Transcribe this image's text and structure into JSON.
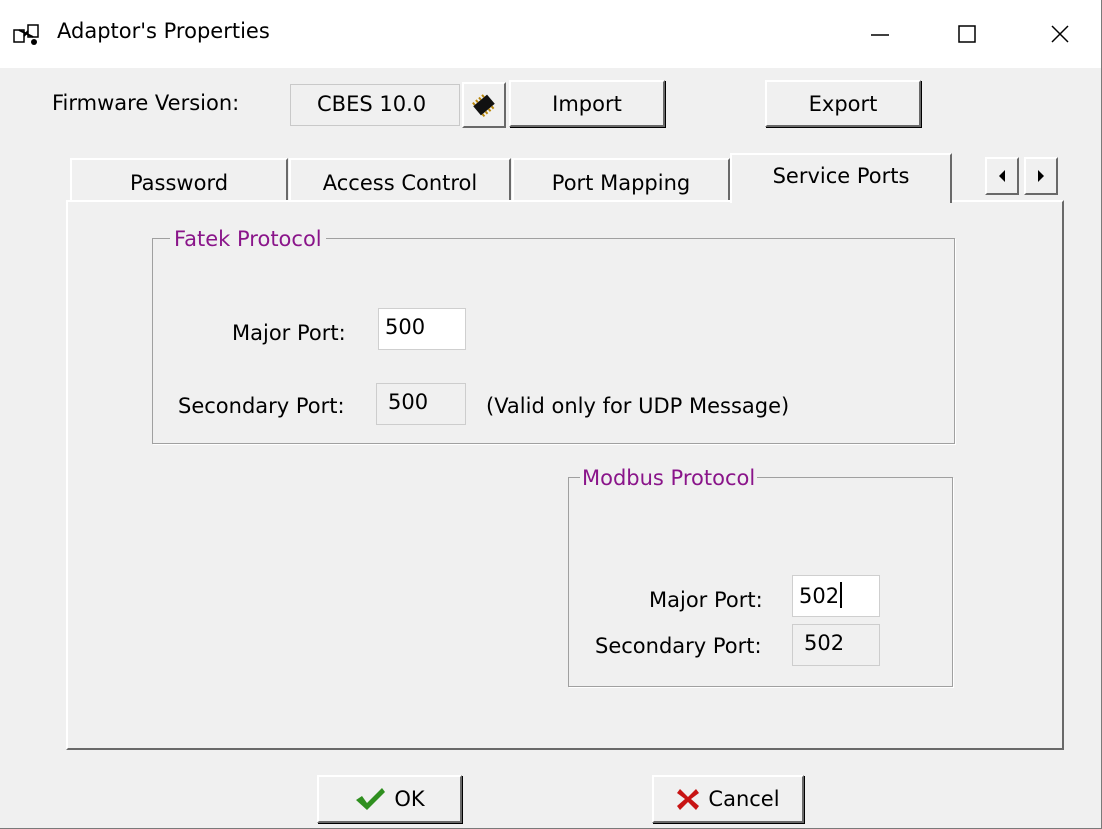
{
  "window": {
    "title": "Adaptor's Properties",
    "icons": {
      "app": "adaptor-network-icon",
      "minimize": "minimize-icon",
      "maximize": "maximize-icon",
      "close": "close-icon"
    }
  },
  "firmware": {
    "label": "Firmware Version:",
    "value": "CBES 10.0",
    "chip_icon": "chip-icon",
    "import_label": "Import",
    "export_label": "Export"
  },
  "tabs": [
    {
      "label": "Password",
      "active": false
    },
    {
      "label": "Access Control",
      "active": false
    },
    {
      "label": "Port Mapping",
      "active": false
    },
    {
      "label": "Service Ports",
      "active": true
    }
  ],
  "tab_scroll": {
    "left_icon": "arrow-left-icon",
    "right_icon": "arrow-right-icon"
  },
  "fatek": {
    "legend": "Fatek Protocol",
    "major_label": "Major Port:",
    "major_value": "500",
    "secondary_label": "Secondary Port:",
    "secondary_value": "500",
    "note": "(Valid only for UDP Message)"
  },
  "modbus": {
    "legend": "Modbus Protocol",
    "major_label": "Major Port:",
    "major_value": "502",
    "secondary_label": "Secondary Port:",
    "secondary_value": "502"
  },
  "footer": {
    "ok_label": "OK",
    "cancel_label": "Cancel",
    "ok_icon": "checkmark-icon",
    "cancel_icon": "x-icon"
  },
  "colors": {
    "group_legend": "#8a158a",
    "ok_check": "#2f8f1f",
    "cancel_x": "#c81414",
    "background": "#f0f0f0"
  }
}
